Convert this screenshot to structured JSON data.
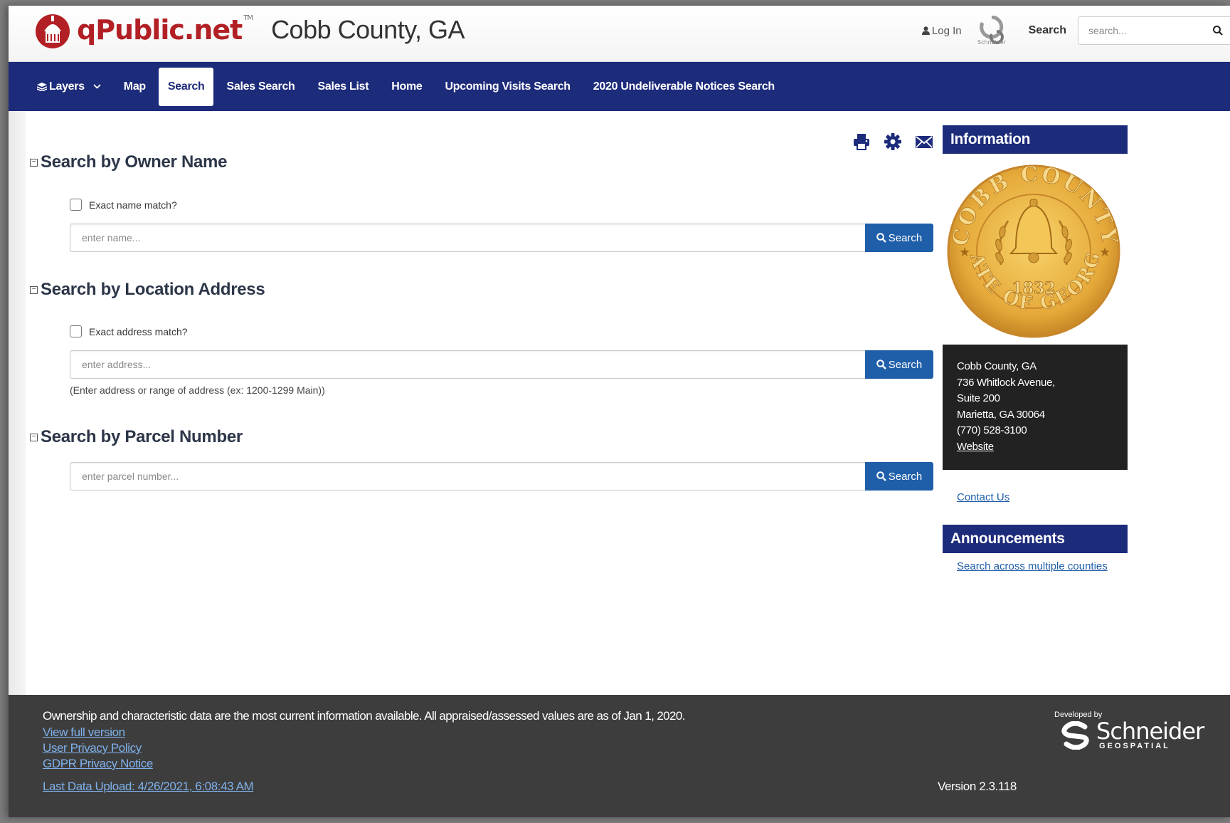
{
  "header": {
    "logo_text": "qPublic.net",
    "logo_tm": "TM",
    "county_title": "Cobb County, GA",
    "login_label": "Log In",
    "schneider_mini_text": "Schneider",
    "search_label": "Search",
    "search_placeholder": "search..."
  },
  "nav": {
    "items": [
      {
        "label": "Layers",
        "active": false
      },
      {
        "label": "Map",
        "active": false
      },
      {
        "label": "Search",
        "active": true
      },
      {
        "label": "Sales Search",
        "active": false
      },
      {
        "label": "Sales List",
        "active": false
      },
      {
        "label": "Home",
        "active": false
      },
      {
        "label": "Upcoming Visits Search",
        "active": false
      },
      {
        "label": "2020 Undeliverable Notices Search",
        "active": false
      }
    ]
  },
  "main": {
    "owner_section": {
      "title": "Search by Owner Name",
      "checkbox_label": "Exact name match?",
      "placeholder": "enter name...",
      "button_label": "Search"
    },
    "address_section": {
      "title": "Search by Location Address",
      "checkbox_label": "Exact address match?",
      "placeholder": "enter address...",
      "button_label": "Search",
      "hint": "(Enter address or range of address (ex: 1200-1299 Main))"
    },
    "parcel_section": {
      "title": "Search by Parcel Number",
      "placeholder": "enter parcel number...",
      "button_label": "Search"
    }
  },
  "sidebar": {
    "information_title": "Information",
    "seal": {
      "top_text": "COBB COUNTY",
      "bottom_text": "STATE OF GEORGIA",
      "year": "1832"
    },
    "address_lines": [
      "Cobb County, GA",
      "736 Whitlock Avenue,",
      "Suite 200",
      "Marietta, GA 30064",
      "(770) 528-3100"
    ],
    "website_label": "Website",
    "contact_label": "Contact Us",
    "announcements_title": "Announcements",
    "announcement_link": "Search across multiple counties"
  },
  "footer": {
    "disclaimer": "Ownership and characteristic data are the most current information available. All appraised/assessed values are as of Jan 1, 2020.",
    "links": [
      "View full version",
      "User Privacy Policy",
      "GDPR Privacy Notice"
    ],
    "last_upload": "Last Data Upload: 4/26/2021, 6:08:43 AM",
    "version": "Version 2.3.118",
    "developed_by": "Developed by",
    "developer_name": "Schneider",
    "developer_sub": "GEOSPATIAL"
  },
  "colors": {
    "nav_bg": "#1d2b7b",
    "button_blue": "#1f5ea8",
    "logo_red": "#b21f24",
    "footer_bg": "#3d3d3d",
    "seal_gold": "#e5a93a"
  }
}
